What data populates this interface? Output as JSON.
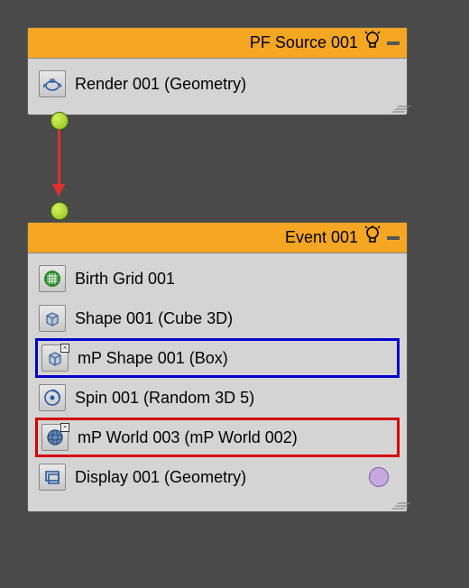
{
  "nodes": {
    "source": {
      "title": "PF Source 001",
      "ops": [
        {
          "label": "Render 001 (Geometry)",
          "icon": "teapot"
        }
      ]
    },
    "event": {
      "title": "Event 001",
      "ops": [
        {
          "label": "Birth Grid 001",
          "icon": "grid",
          "highlight": null
        },
        {
          "label": "Shape 001 (Cube 3D)",
          "icon": "cube",
          "highlight": null
        },
        {
          "label": "mP Shape 001 (Box)",
          "icon": "cube-x",
          "highlight": "blue"
        },
        {
          "label": "Spin 001 (Random 3D 5)",
          "icon": "spin",
          "highlight": null
        },
        {
          "label": "mP World 003 (mP World 002)",
          "icon": "globe-x",
          "highlight": "red"
        },
        {
          "label": "Display 001 (Geometry)",
          "icon": "display",
          "highlight": null,
          "trailingDot": true
        }
      ]
    }
  },
  "colors": {
    "header": "#f5a623",
    "highlightBlue": "#0000cc",
    "highlightRed": "#d40000",
    "connector": "#8bbf1f",
    "arrow": "#e03030"
  }
}
